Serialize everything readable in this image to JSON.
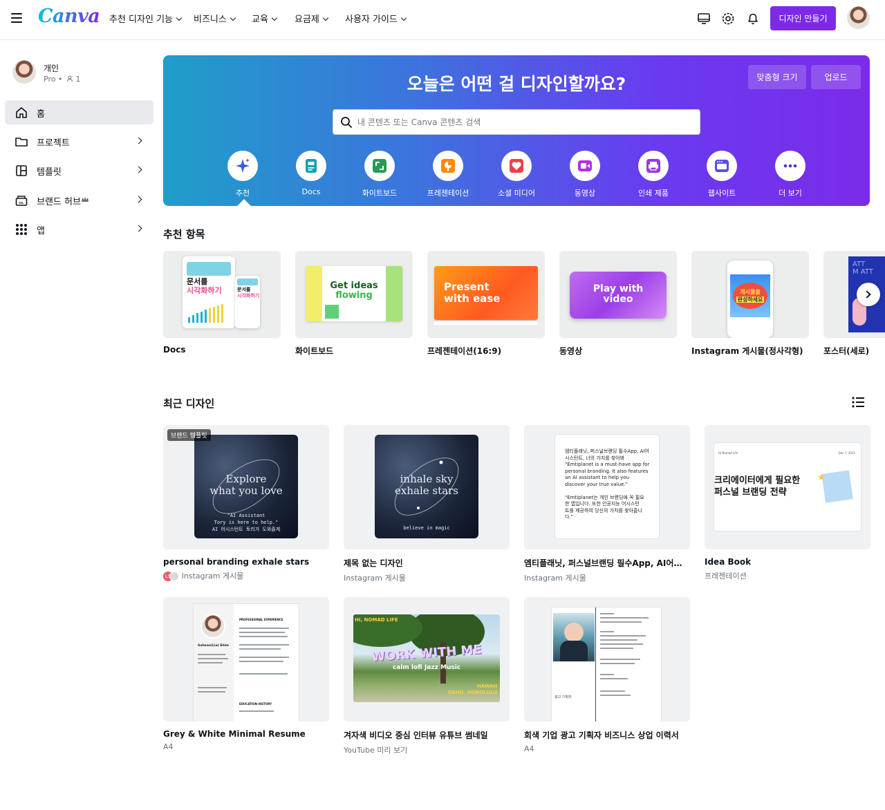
{
  "header": {
    "logo": "Canva",
    "nav": [
      "추천 디자인 기능",
      "비즈니스",
      "교육",
      "요금제",
      "사용자 가이드"
    ],
    "create_label": "디자인 만들기"
  },
  "sidebar": {
    "profile": {
      "name": "개인",
      "plan": "Pro •",
      "members": "1"
    },
    "items": [
      {
        "label": "홈"
      },
      {
        "label": "프로젝트"
      },
      {
        "label": "템플릿"
      },
      {
        "label": "브랜드 허브"
      },
      {
        "label": "앱"
      }
    ]
  },
  "hero": {
    "title": "오늘은 어떤 걸 디자인할까요?",
    "custom_size": "맞춤형 크기",
    "upload": "업로드",
    "search_placeholder": "내 콘텐츠 또는 Canva 콘텐츠 검색",
    "categories": [
      {
        "label": "추천",
        "icon": "sparkle-icon",
        "color": "#3b5bdb"
      },
      {
        "label": "Docs",
        "icon": "docs-icon",
        "color": "#13a3b5"
      },
      {
        "label": "화이트보드",
        "icon": "whiteboard-icon",
        "color": "#2c9a57"
      },
      {
        "label": "프레젠테이션",
        "icon": "presentation-icon",
        "color": "#ff8a00"
      },
      {
        "label": "소셜 미디어",
        "icon": "heart-icon",
        "color": "#ef3f46"
      },
      {
        "label": "동영상",
        "icon": "video-icon",
        "color": "#b02eec"
      },
      {
        "label": "인쇄 제품",
        "icon": "print-icon",
        "color": "#9a37e6"
      },
      {
        "label": "웹사이트",
        "icon": "website-icon",
        "color": "#5a4ee8"
      },
      {
        "label": "더 보기",
        "icon": "more-icon",
        "color": "#5b2bd8"
      }
    ]
  },
  "recommended": {
    "title": "추천 항목",
    "items": [
      {
        "label": "Docs",
        "thumb_text_1": "문서를",
        "thumb_text_2": "시각화하기"
      },
      {
        "label": "화이트보드",
        "thumb_text_1": "Get ideas",
        "thumb_text_2": "flowing"
      },
      {
        "label": "프레젠테이션(16:9)",
        "thumb_text_1": "Present",
        "thumb_text_2": "with ease"
      },
      {
        "label": "동영상",
        "thumb_text_1": "Play with",
        "thumb_text_2": "video"
      },
      {
        "label": "Instagram 게시물(정사각형)",
        "thumb_text_1": "게시물을",
        "thumb_text_2": "완성하세요"
      },
      {
        "label": "포스터(세로)",
        "thumb_text_1": "ATT",
        "thumb_text_2": "M ATT"
      }
    ]
  },
  "recent": {
    "title": "최근 디자인",
    "designs": [
      {
        "title": "personal branding exhale stars",
        "type": "Instagram 게시물",
        "badge": "브랜드 템플릿",
        "owner_initials": "LS",
        "thumb": {
          "line1": "Explore",
          "line2": "what you love",
          "small1": "\"AI Assistant",
          "small2": "Tory is here to help.\"",
          "small3": "AI 어시스턴트 토리가 도와줄게"
        }
      },
      {
        "title": "제목 없는 디자인",
        "type": "Instagram 게시물",
        "thumb": {
          "line1": "inhale sky",
          "line2": "exhale stars",
          "small1": "believe in magic"
        }
      },
      {
        "title": "엠티플래닛, 퍼스널브랜딩 필수App, AI어시스턴트, 너의 가치를 찾아봐",
        "type": "Instagram 게시물",
        "thumb": {
          "text": "엠티플래닛, 퍼스널브랜딩 필수App, AI어\n시스턴트, 너의 가치를 찾아봐\n\"Emtiplanet is a must-have app for\npersonal branding. It also features\nan AI assistant to help you\ndiscover your true value.\"\n\n\"Emtiplanet는 개인 브랜딩에 꼭 필요\n한 앱입니다. 또한 인공지능 어시스턴\n트를 제공하여 당신의 가치를 찾아줍니\n다.\""
        }
      },
      {
        "title": "Idea Book",
        "type": "프레젠테이션",
        "thumb": {
          "text": "크리에이터에게 필요한\n퍼스널 브랜딩 전략",
          "small1": "Hi Nomad Life",
          "small2": "Dec 7, 2022"
        }
      },
      {
        "title": "Grey & White Minimal Resume",
        "type": "A4",
        "thumb": {
          "name": "Suheon(Lia) Shim",
          "h1": "PROFESSIONAL EXPERIENCE",
          "h2": "EDUCATION HISTORY"
        }
      },
      {
        "title": "겨자색 비디오 중심 인터뷰 유튜브 썸네일",
        "type": "YouTube 미리 보기",
        "thumb": {
          "top": "HI, NOMAD LIFE",
          "line1": "WORK WITH ME",
          "line2": "calm lofi Jazz Music",
          "loc1": "HAWAII",
          "loc2": "OAHU, HONOLULU"
        }
      },
      {
        "title": "회색 기업 광고 기획자 비즈니스 상업 이력서",
        "type": "A4",
        "thumb": {
          "sign": "광고 기획자"
        }
      }
    ]
  },
  "colors": {
    "accent": "#7d2ae8",
    "text": "#0e1318",
    "muted": "#6b7179"
  }
}
